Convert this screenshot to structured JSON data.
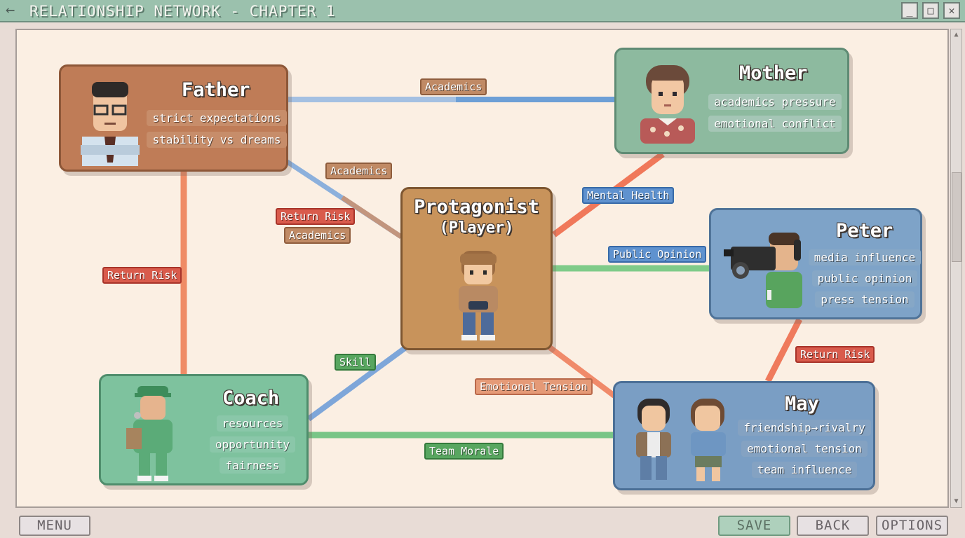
{
  "window": {
    "title": "RELATIONSHIP NETWORK - CHAPTER 1",
    "back_icon": "←",
    "minimize": "_",
    "maximize": "□",
    "close": "✕"
  },
  "nodes": {
    "father": {
      "name": "Father",
      "tags": [
        "strict expectations",
        "stability vs dreams"
      ],
      "color": "#bf7c57"
    },
    "mother": {
      "name": "Mother",
      "tags": [
        "academics pressure",
        "emotional conflict"
      ],
      "color": "#8dba9f"
    },
    "protagonist": {
      "name": "Protagonist",
      "subname": "(Player)",
      "color": "#c8935b"
    },
    "peter": {
      "name": "Peter",
      "tags": [
        "media influence",
        "public opinion",
        "press tension"
      ],
      "color": "#7ea3c8"
    },
    "coach": {
      "name": "Coach",
      "tags": [
        "resources",
        "opportunity",
        "fairness"
      ],
      "color": "#7ec29e"
    },
    "may": {
      "name": "May",
      "tags": [
        "friendship→rivalry",
        "emotional tension",
        "team influence"
      ],
      "color": "#7a9ec4"
    }
  },
  "edges": [
    {
      "from": "Father",
      "to": "Mother",
      "label": "Academics",
      "color": "#6d9fd6"
    },
    {
      "from": "Father",
      "to": "Protagonist",
      "label": "Academics",
      "color": "#7aa3d8"
    },
    {
      "from": "Father",
      "to": "Protagonist",
      "labels": [
        "Return Risk",
        "Academics"
      ],
      "color": "#b88a73"
    },
    {
      "from": "Father",
      "to": "Coach",
      "label": "Return Risk",
      "color": "#ef7a5c"
    },
    {
      "from": "Mother",
      "to": "Protagonist",
      "label": "Mental Health",
      "color": "#ef6a4f"
    },
    {
      "from": "Protagonist",
      "to": "Peter",
      "label": "Public Opinion",
      "color": "#6cc47a"
    },
    {
      "from": "Peter",
      "to": "May",
      "label": "Return Risk",
      "color": "#ef6a4f"
    },
    {
      "from": "Protagonist",
      "to": "Coach",
      "label": "Skill",
      "color": "#6d9fd6"
    },
    {
      "from": "Protagonist",
      "to": "May",
      "label": "Emotional Tension",
      "color": "#f08060"
    },
    {
      "from": "Coach",
      "to": "May",
      "label": "Team Morale",
      "color": "#6cc47a"
    }
  ],
  "icons": {
    "scroll_up": "▲",
    "scroll_down": "▼"
  },
  "buttons": {
    "menu": "MENU",
    "save": "SAVE",
    "back": "BACK",
    "options": "OPTIONS"
  }
}
